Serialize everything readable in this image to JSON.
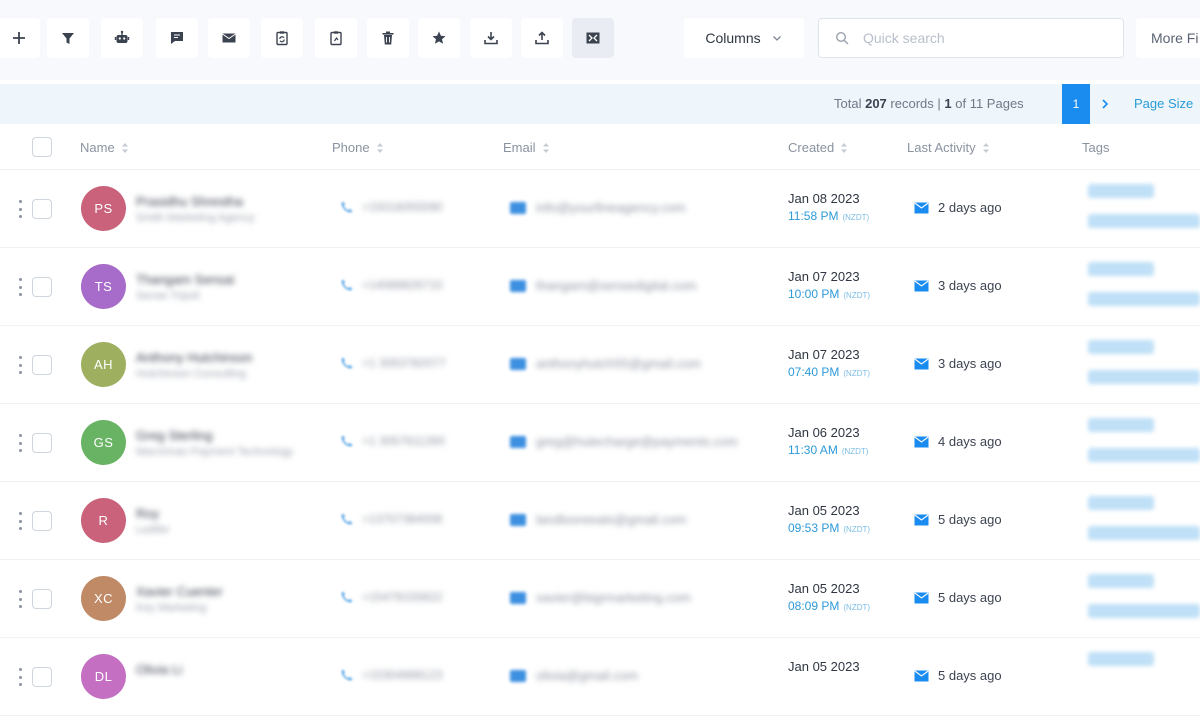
{
  "toolbar": {
    "buttons": [
      {
        "name": "add-button",
        "icon": "plus-icon"
      },
      {
        "name": "filter-button",
        "icon": "filter-icon"
      },
      {
        "name": "bot-button",
        "icon": "robot-icon"
      },
      {
        "name": "message-button",
        "icon": "chat-icon"
      },
      {
        "name": "email-button",
        "icon": "mail-icon"
      },
      {
        "name": "copy-button",
        "icon": "clipboard-sync-icon"
      },
      {
        "name": "clipboard-button",
        "icon": "clipboard-icon"
      },
      {
        "name": "delete-button",
        "icon": "trash-icon"
      },
      {
        "name": "favorite-button",
        "icon": "star-icon"
      },
      {
        "name": "import-button",
        "icon": "download-icon"
      },
      {
        "name": "export-button",
        "icon": "upload-icon"
      },
      {
        "name": "merge-button",
        "icon": "merge-icon"
      }
    ],
    "columns_label": "Columns",
    "search_placeholder": "Quick search",
    "more_label": "More Fi"
  },
  "pager": {
    "total_prefix": "Total",
    "total_count": "207",
    "records_text": "records |",
    "current_page": "1",
    "of_text": "of 11 Pages",
    "page_button": "1",
    "page_size_label": "Page Size"
  },
  "columns": {
    "name": "Name",
    "phone": "Phone",
    "email": "Email",
    "created": "Created",
    "last_activity": "Last Activity",
    "tags": "Tags"
  },
  "rows": [
    {
      "initials": "PS",
      "color": "#c9627a",
      "name": "Prasidhu Shrestha",
      "company": "Smith Marketing Agency",
      "phone": "+15016055590",
      "email": "info@yourfineagency.com",
      "date": "Jan 08 2023",
      "time": "11:58 PM",
      "tz": "(NZDT)",
      "activity": "2 days ago"
    },
    {
      "initials": "TS",
      "color": "#a76bc9",
      "name": "Thangam Sensai",
      "company": "Sense Tripoli",
      "phone": "+14088826710",
      "email": "thangam@sensedigital.com",
      "date": "Jan 07 2023",
      "time": "10:00 PM",
      "tz": "(NZDT)",
      "activity": "3 days ago"
    },
    {
      "initials": "AH",
      "color": "#9eb060",
      "name": "Anthony Hutchinson",
      "company": "Hutchinson Consulting",
      "phone": "+1 3053782077",
      "email": "anthonyhutch55@gmail.com",
      "date": "Jan 07 2023",
      "time": "07:40 PM",
      "tz": "(NZDT)",
      "activity": "3 days ago"
    },
    {
      "initials": "GS",
      "color": "#68b364",
      "name": "Greg Sterling",
      "company": "Marchman Payment Technology",
      "phone": "+1 3057611260",
      "email": "greg@hutecharge@payments.com",
      "date": "Jan 06 2023",
      "time": "11:30 AM",
      "tz": "(NZDT)",
      "activity": "4 days ago"
    },
    {
      "initials": "R",
      "color": "#c9627a",
      "name": "Roy",
      "company": "Ledifer",
      "phone": "+13707384006",
      "email": "landlooreeats@gmail.com",
      "date": "Jan 05 2023",
      "time": "09:53 PM",
      "tz": "(NZDT)",
      "activity": "5 days ago"
    },
    {
      "initials": "XC",
      "color": "#c08a66",
      "name": "Xavier Cuenter",
      "company": "Key Marketing",
      "phone": "+15479155822",
      "email": "xavier@bigrmarketing.com",
      "date": "Jan 05 2023",
      "time": "08:09 PM",
      "tz": "(NZDT)",
      "activity": "5 days ago"
    },
    {
      "initials": "DL",
      "color": "#c46fc2",
      "name": "Olivia Li",
      "company": "",
      "phone": "+15304998123",
      "email": "olivia@gmail.com",
      "date": "Jan 05 2023",
      "time": "",
      "tz": "",
      "activity": "5 days ago"
    }
  ]
}
